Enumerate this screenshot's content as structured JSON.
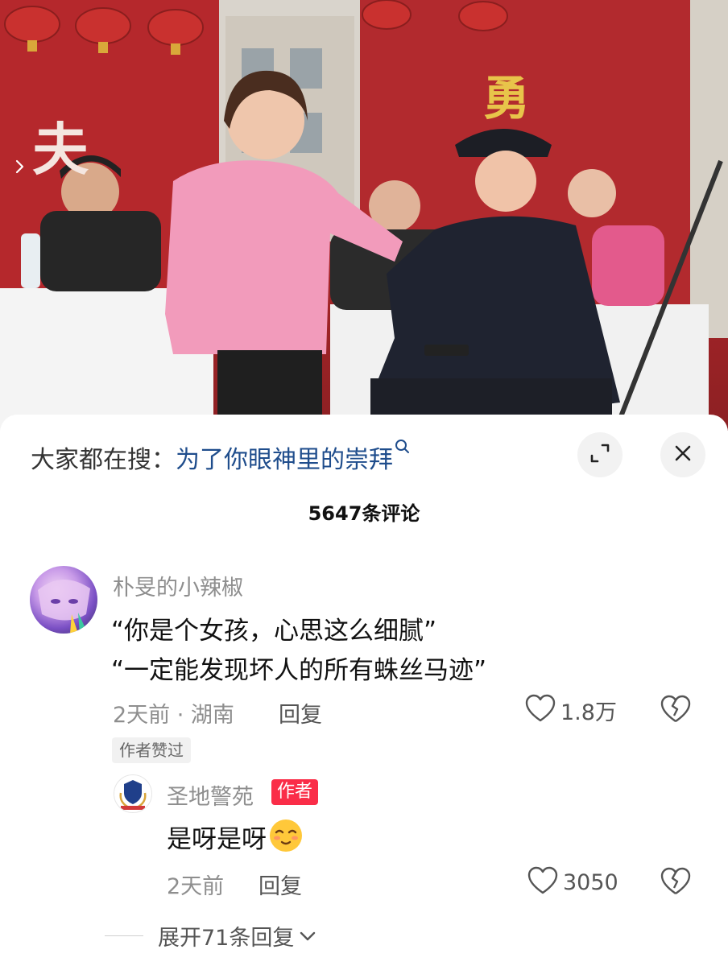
{
  "photo": {
    "banner_chars": [
      "勇",
      "夫"
    ]
  },
  "search": {
    "prefix": "大家都在搜：",
    "term": "为了你眼神里的崇拜",
    "icon": "search-icon"
  },
  "controls": {
    "expand_icon": "expand-icon",
    "close_icon": "close-icon"
  },
  "comments_header": {
    "count_label": "5647条评论"
  },
  "comment": {
    "username": "朴旻的小辣椒",
    "lines": [
      "“你是个女孩，心思这么细腻”",
      "“一定能发现坏人的所有蛛丝马迹”"
    ],
    "meta": "2天前 · 湖南",
    "reply_label": "回复",
    "likes": "1.8万",
    "author_liked_tag": "作者赞过"
  },
  "reply": {
    "username": "圣地警苑",
    "badge": "作者",
    "text": "是呀是呀",
    "meta": "2天前",
    "reply_label": "回复",
    "likes": "3050"
  },
  "expand_replies": {
    "label": "展开71条回复"
  },
  "colors": {
    "search_term": "#1f4d8c",
    "author_badge": "#fa2d48",
    "banner_red": "#b22a2e",
    "banner_gold": "#e8c44a"
  }
}
